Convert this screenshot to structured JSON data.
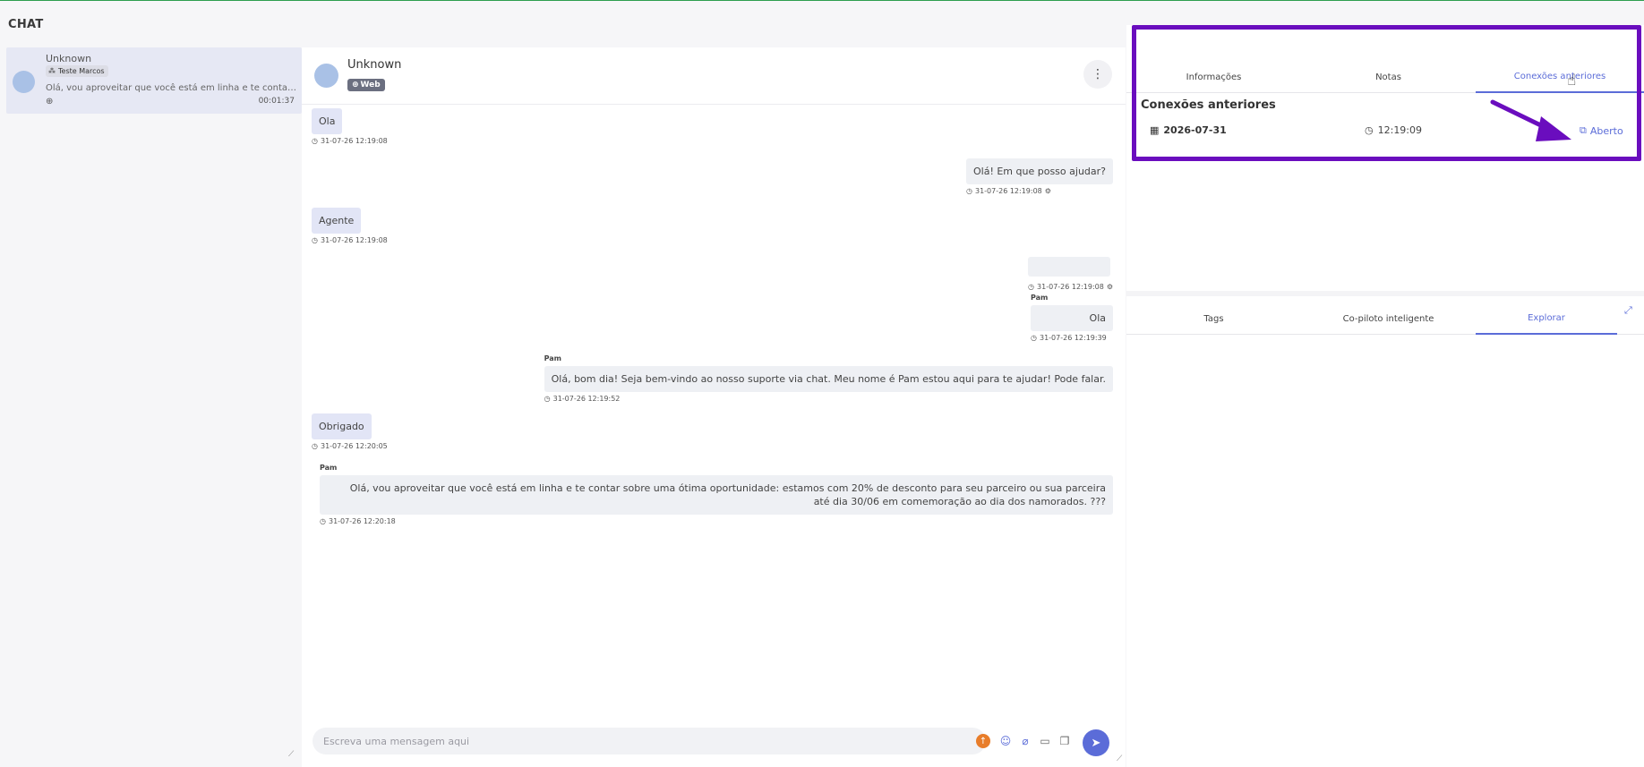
{
  "app": {
    "title": "CHAT"
  },
  "conversation_list": [
    {
      "name": "Unknown",
      "badge": "Teste Marcos",
      "preview": "Olá, vou aproveitar que você está em linha e te contar sobre uma ótima oportunidade",
      "duration": "00:01:37"
    }
  ],
  "chat": {
    "contact_name": "Unknown",
    "channel": "Web",
    "messages": [
      {
        "direction": "in",
        "text": "Ola",
        "time": "31-07-26 12:19:08"
      },
      {
        "direction": "out",
        "text": "Olá! Em que posso ajudar?",
        "time": "31-07-26 12:19:08",
        "bot": true
      },
      {
        "direction": "in",
        "text": "Agente",
        "time": "31-07-26 12:19:08"
      },
      {
        "direction": "out",
        "text": "",
        "time": "31-07-26 12:19:08",
        "bot": true
      },
      {
        "direction": "out",
        "sender": "Pam",
        "text": "Ola",
        "time": "31-07-26 12:19:39"
      },
      {
        "direction": "out",
        "sender": "Pam",
        "text": "Olá, bom dia! Seja bem-vindo ao nosso suporte via chat. Meu nome é Pam estou aqui para te ajudar! Pode falar.",
        "time": "31-07-26 12:19:52"
      },
      {
        "direction": "in",
        "text": "Obrigado",
        "time": "31-07-26 12:20:05"
      },
      {
        "direction": "out",
        "sender": "Pam",
        "text": "Olá, vou aproveitar que você está em linha e te contar sobre uma ótima oportunidade: estamos com 20% de desconto para seu parceiro ou sua parceira até dia 30/06 em comemoração ao dia dos namorados. ???",
        "time": "31-07-26 12:20:18"
      }
    ],
    "composer_placeholder": "Escreva uma mensagem aqui"
  },
  "right_panel": {
    "top_tabs": [
      {
        "label": "Informações",
        "active": false
      },
      {
        "label": "Notas",
        "active": false
      },
      {
        "label": "Conexões anteriores",
        "active": true
      }
    ],
    "section_title": "Conexões anteriores",
    "connection": {
      "date": "2026-07-31",
      "time": "12:19:09",
      "link_label": "Aberto"
    },
    "bottom_tabs": [
      {
        "label": "Tags",
        "active": false
      },
      {
        "label": "Co-piloto inteligente",
        "active": false
      },
      {
        "label": "Explorar",
        "active": true
      }
    ]
  },
  "colors": {
    "accent": "#5b6cd8",
    "annotation": "#6a0dbe",
    "upload": "#e87d2a"
  },
  "icons": [
    "avatar",
    "users-icon",
    "globe-icon",
    "kebab-icon",
    "clock-icon",
    "robot-icon",
    "calendar-icon",
    "external-link-icon",
    "upload-icon",
    "emoji-icon",
    "attach-icon",
    "video-icon",
    "window-icon",
    "send-icon",
    "expand-icon",
    "cursor-hand-icon",
    "annotation-arrow"
  ]
}
